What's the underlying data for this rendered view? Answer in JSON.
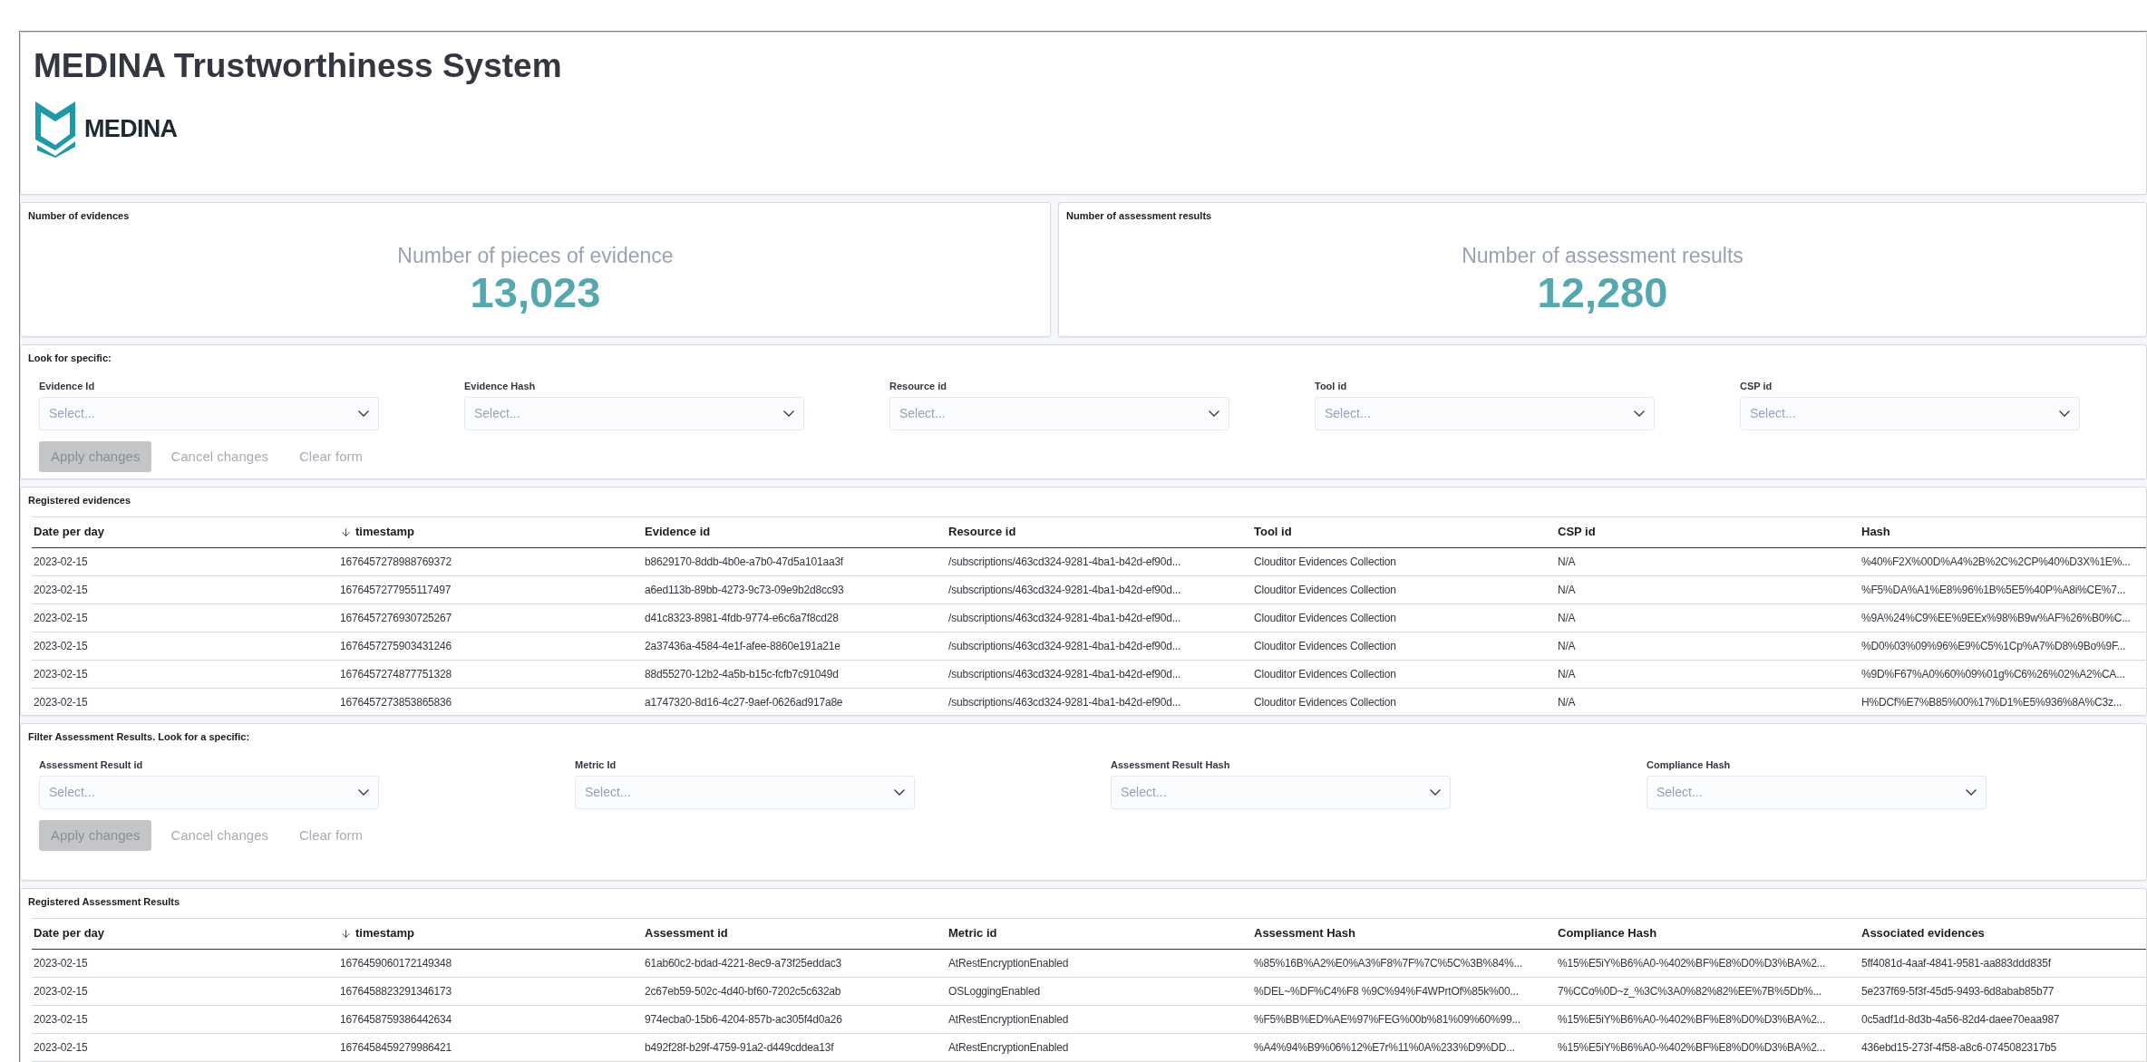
{
  "title": "MEDINA Trustworthiness System",
  "logo": {
    "text": "MEDINA"
  },
  "metrics": [
    {
      "panel_title": "Number of evidences",
      "label": "Number of pieces of evidence",
      "value": "13,023"
    },
    {
      "panel_title": "Number of assessment results",
      "label": "Number of assessment results",
      "value": "12,280"
    }
  ],
  "evidence_filter": {
    "title": "Look for specific:",
    "fields": [
      {
        "label": "Evidence Id",
        "placeholder": "Select..."
      },
      {
        "label": "Evidence Hash",
        "placeholder": "Select..."
      },
      {
        "label": "Resource id",
        "placeholder": "Select..."
      },
      {
        "label": "Tool id",
        "placeholder": "Select..."
      },
      {
        "label": "CSP id",
        "placeholder": "Select..."
      }
    ],
    "buttons": [
      {
        "label": "Apply changes",
        "kind": "filled",
        "disabled": true
      },
      {
        "label": "Cancel changes",
        "kind": "empty",
        "disabled": true
      },
      {
        "label": "Clear form",
        "kind": "empty",
        "disabled": true
      }
    ]
  },
  "evidence_table": {
    "title": "Registered evidences",
    "columns": [
      {
        "label": "Date per day",
        "sorted": false
      },
      {
        "label": "timestamp",
        "sorted": true
      },
      {
        "label": "Evidence id",
        "sorted": false
      },
      {
        "label": "Resource id",
        "sorted": false
      },
      {
        "label": "Tool id",
        "sorted": false
      },
      {
        "label": "CSP id",
        "sorted": false
      },
      {
        "label": "Hash",
        "sorted": false
      }
    ],
    "rows": [
      [
        "2023-02-15",
        "1676457278988769372",
        "b8629170-8ddb-4b0e-a7b0-47d5a101aa3f",
        "/subscriptions/463cd324-9281-4ba1-b42d-ef90d...",
        "Clouditor Evidences Collection",
        "N/A",
        "%40%F2X%00D%A4%2B%2C%2CP%40%D3X%1E%..."
      ],
      [
        "2023-02-15",
        "1676457277955117497",
        "a6ed113b-89bb-4273-9c73-09e9b2d8cc93",
        "/subscriptions/463cd324-9281-4ba1-b42d-ef90d...",
        "Clouditor Evidences Collection",
        "N/A",
        "%F5%DA%A1%E8%96%1B%5E5%40P%A8i%CE%7..."
      ],
      [
        "2023-02-15",
        "1676457276930725267",
        "d41c8323-8981-4fdb-9774-e6c6a7f8cd28",
        "/subscriptions/463cd324-9281-4ba1-b42d-ef90d...",
        "Clouditor Evidences Collection",
        "N/A",
        "%9A%24%C9%EE%9EEx%98%B9w%AF%26%B0%C..."
      ],
      [
        "2023-02-15",
        "1676457275903431246",
        "2a37436a-4584-4e1f-afee-8860e191a21e",
        "/subscriptions/463cd324-9281-4ba1-b42d-ef90d...",
        "Clouditor Evidences Collection",
        "N/A",
        "%D0%03%09%96%E9%C5%1Cp%A7%D8%9Bo%9F..."
      ],
      [
        "2023-02-15",
        "1676457274877751328",
        "88d55270-12b2-4a5b-b15c-fcfb7c91049d",
        "/subscriptions/463cd324-9281-4ba1-b42d-ef90d...",
        "Clouditor Evidences Collection",
        "N/A",
        "%9D%F67%A0%60%09%01g%C6%26%02%A2%CA..."
      ],
      [
        "2023-02-15",
        "1676457273853865836",
        "a1747320-8d16-4c27-9aef-0626ad917a8e",
        "/subscriptions/463cd324-9281-4ba1-b42d-ef90d...",
        "Clouditor Evidences Collection",
        "N/A",
        "H%DCf%E7%B85%00%17%D1%E5%936%8A%C3z..."
      ]
    ]
  },
  "assessment_filter": {
    "title": "Filter Assessment Results. Look for a specific:",
    "fields": [
      {
        "label": "Assessment Result id",
        "placeholder": "Select..."
      },
      {
        "label": "Metric Id",
        "placeholder": "Select..."
      },
      {
        "label": "Assessment Result Hash",
        "placeholder": "Select..."
      },
      {
        "label": "Compliance Hash",
        "placeholder": "Select..."
      }
    ],
    "buttons": [
      {
        "label": "Apply changes",
        "kind": "filled",
        "disabled": true
      },
      {
        "label": "Cancel changes",
        "kind": "empty",
        "disabled": true
      },
      {
        "label": "Clear form",
        "kind": "empty",
        "disabled": true
      }
    ]
  },
  "assessment_table": {
    "title": "Registered Assessment Results",
    "columns": [
      {
        "label": "Date per day",
        "sorted": false
      },
      {
        "label": "timestamp",
        "sorted": true
      },
      {
        "label": "Assessment id",
        "sorted": false
      },
      {
        "label": "Metric id",
        "sorted": false
      },
      {
        "label": "Assessment Hash",
        "sorted": false
      },
      {
        "label": "Compliance Hash",
        "sorted": false
      },
      {
        "label": "Associated evidences",
        "sorted": false
      }
    ],
    "rows": [
      [
        "2023-02-15",
        "1676459060172149348",
        "61ab60c2-bdad-4221-8ec9-a73f25eddac3",
        "AtRestEncryptionEnabled",
        "%85%16B%A2%E0%A3%F8%7F%7C%5C%3B%84%...",
        "%15%E5iY%B6%A0-%402%BF%E8%D0%D3%BA%2...",
        "5ff4081d-4aaf-4841-9581-aa883ddd835f"
      ],
      [
        "2023-02-15",
        "1676458823291346173",
        "2c67eb59-502c-4d40-bf60-7202c5c632ab",
        "OSLoggingEnabled",
        "%DEL~%DF%C4%F8 %9C%94%F4WPrtOf%85k%00...",
        "7%CCo%0D~z_%3C%3A0%82%82%EE%7B%5Db%...",
        "5e237f69-5f3f-45d5-9493-6d8abab85b77"
      ],
      [
        "2023-02-15",
        "1676458759386442634",
        "974ecba0-15b6-4204-857b-ac305f4d0a26",
        "AtRestEncryptionEnabled",
        "%F5%BB%ED%AE%97%FEG%00b%81%09%60%99...",
        "%15%E5iY%B6%A0-%402%BF%E8%D0%D3%BA%2...",
        "0c5adf1d-8d3b-4a56-82d4-daee70eaa987"
      ],
      [
        "2023-02-15",
        "1676458459279986421",
        "b492f28f-b29f-4759-91a2-d449cddea13f",
        "AtRestEncryptionEnabled",
        "%A4%94%B9%06%12%E7r%11%0A%233%D9%DD...",
        "%15%E5iY%B6%A0-%402%BF%E8%D0%D3%BA%2...",
        "436ebd15-273f-4f58-a8c6-0745082317b5"
      ]
    ]
  }
}
